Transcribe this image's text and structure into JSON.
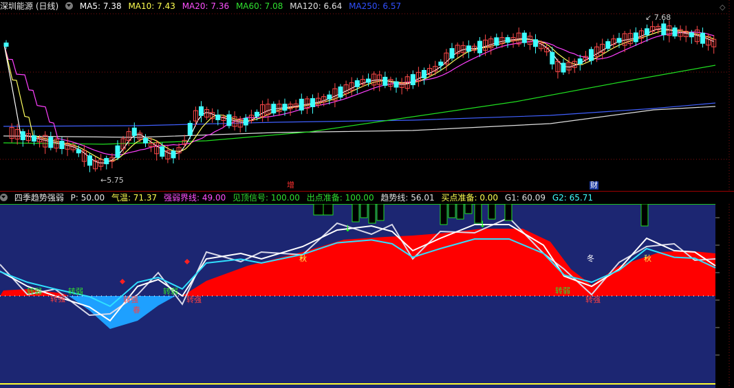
{
  "main_header": {
    "title": "深圳能源 (日线)",
    "ma5_label": "MA5: 7.38",
    "ma10_label": "MA10: 7.43",
    "ma20_label": "MA20: 7.36",
    "ma60_label": "MA60: 7.08",
    "ma120_label": "MA120: 6.64",
    "ma250_label": "MA250: 6.57"
  },
  "main_chart": {
    "high_label": "7.68",
    "low_label": "5.75",
    "event_marks": [
      "增",
      "财"
    ],
    "colors": {
      "up": "#ff4a4a",
      "down": "#40ffff",
      "ma5": "#ffffff",
      "ma10": "#ffff60",
      "ma20": "#ff40ff",
      "ma60": "#20e020",
      "ma120": "#e0e0e0",
      "ma250": "#4060ff"
    }
  },
  "indicator_header": {
    "name": "四季趋势强弱",
    "p_label": "P: 50.00",
    "temp_label": "气温: 71.37",
    "boundary_label": "强弱界线: 49.00",
    "top_signal_label": "见顶信号: 100.00",
    "exit_ready_label": "出点准备: 100.00",
    "trend_label": "趋势线: 56.01",
    "buy_ready_label": "买点准备: 0.00",
    "g1_label": "G1: 60.09",
    "g2_label": "G2: 65.71"
  },
  "indicator_chart": {
    "labels": {
      "turn_weak": "转弱",
      "turn_strong": "转强",
      "spring": "春",
      "autumn": "秋",
      "winter": "冬"
    },
    "colors": {
      "background": "#1c2672",
      "strong_fill": "#ff0000",
      "weak_fill": "#1ea0ff"
    }
  }
}
